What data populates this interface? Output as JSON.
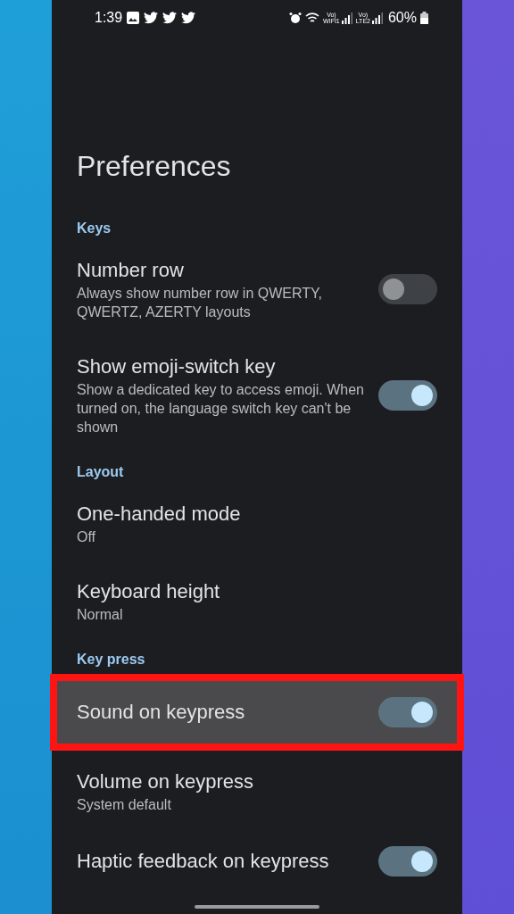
{
  "status_bar": {
    "time": "1:39",
    "sims": [
      {
        "top": "Vo)",
        "bottom": "WIFI1"
      },
      {
        "top": "Vo)",
        "bottom": "LTE2"
      }
    ],
    "battery": "60%"
  },
  "title": "Preferences",
  "sections": [
    {
      "header": "Keys",
      "items": [
        {
          "kind": "toggle",
          "title": "Number row",
          "subtitle": "Always show number row in QWERTY, QWERTZ, AZERTY layouts",
          "on": false,
          "highlighted": false
        },
        {
          "kind": "toggle",
          "title": "Show emoji-switch key",
          "subtitle": "Show a dedicated key to access emoji. When turned on, the language switch key can't be shown",
          "on": true,
          "highlighted": false
        }
      ]
    },
    {
      "header": "Layout",
      "items": [
        {
          "kind": "value",
          "title": "One-handed mode",
          "subtitle": "Off",
          "highlighted": false
        },
        {
          "kind": "value",
          "title": "Keyboard height",
          "subtitle": "Normal",
          "highlighted": false
        }
      ]
    },
    {
      "header": "Key press",
      "items": [
        {
          "kind": "toggle",
          "title": "Sound on keypress",
          "on": true,
          "highlighted": true
        },
        {
          "kind": "value",
          "title": "Volume on keypress",
          "subtitle": "System default",
          "highlighted": false
        },
        {
          "kind": "toggle",
          "title": "Haptic feedback on keypress",
          "on": true,
          "highlighted": false
        }
      ]
    }
  ]
}
